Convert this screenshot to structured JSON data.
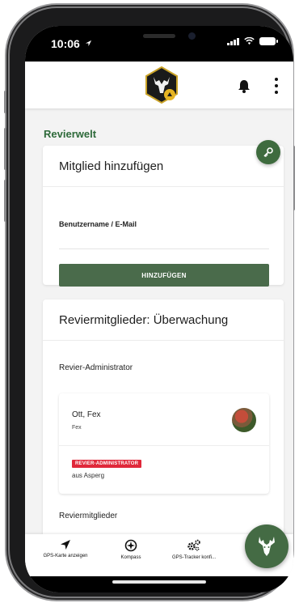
{
  "status_bar": {
    "time": "10:06"
  },
  "app_bar": {
    "logo_icon": "hunter-deer-logo",
    "notification_icon": "bell-icon",
    "menu_icon": "kebab-menu-icon"
  },
  "section_title": "Revierwelt",
  "add_member_card": {
    "title": "Mitglied hinzufügen",
    "field_label": "Benutzername / E-Mail",
    "field_value": "",
    "submit_label": "HINZUFÜGEN",
    "action_icon": "key-icon"
  },
  "members_card": {
    "title": "Reviermitglieder: Überwachung",
    "admin_section_label": "Revier-Administrator",
    "admin": {
      "name": "Ott, Fex",
      "username": "Fex",
      "role_badge": "REVIER-ADMINISTRATOR",
      "origin": "aus Asperg"
    },
    "members_section_label": "Reviermitglieder"
  },
  "bottom_nav": {
    "items": [
      {
        "label": "GPS-Karte anzeigen",
        "icon": "navigation-arrow-icon"
      },
      {
        "label": "Kompass",
        "icon": "compass-icon"
      },
      {
        "label": "GPS-Tracker konfi...",
        "icon": "gears-icon"
      }
    ]
  },
  "fab": {
    "icon": "deer-head-icon"
  },
  "colors": {
    "brand_green": "#2e6a3a",
    "button_green": "#4a6b4b",
    "badge_red": "#e0283a"
  }
}
